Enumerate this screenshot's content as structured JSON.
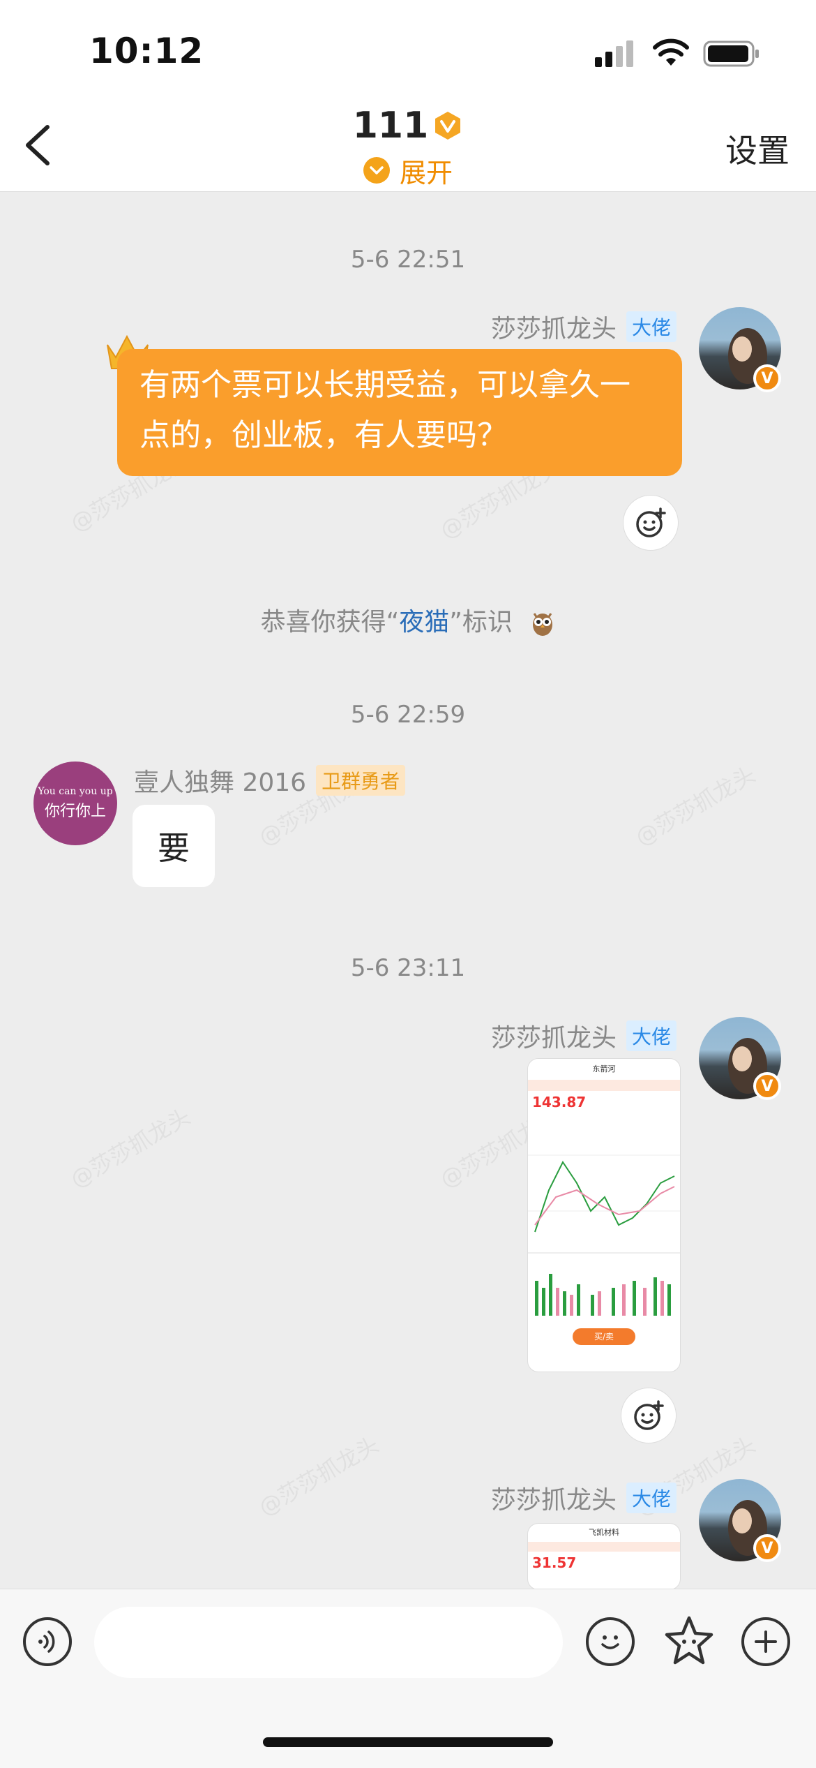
{
  "status_bar": {
    "time": "10:12"
  },
  "header": {
    "title": "111",
    "expand_label": "展开",
    "settings_label": "设置"
  },
  "watermark_text": "@莎莎抓龙头",
  "messages": {
    "ts1": "5-6 22:51",
    "msg1": {
      "sender": "莎莎抓龙头",
      "tag": "大佬",
      "text": "有两个票可以长期受益，可以拿久一点的，创业板，有人要吗？"
    },
    "notice": {
      "prefix": "恭喜你获得“",
      "highlight": "夜猫",
      "suffix": "”标识"
    },
    "ts2": "5-6 22:59",
    "msg2": {
      "sender": "壹人独舞 2016",
      "tag": "卫群勇者",
      "avatar_top": "You can you up",
      "avatar_bottom": "你行你上",
      "text": "要"
    },
    "ts3": "5-6 23:11",
    "msg3": {
      "sender": "莎莎抓龙头",
      "tag": "大佬",
      "price": "143.87",
      "stock_name": "东箭河",
      "button": "买/卖"
    },
    "msg4": {
      "sender": "莎莎抓龙头",
      "tag": "大佬",
      "price": "31.57",
      "stock_name": "飞凯材料"
    }
  },
  "colors": {
    "accent": "#fa9e2c",
    "tag_blue": "#2a89e6",
    "tag_orange": "#e89a16"
  }
}
